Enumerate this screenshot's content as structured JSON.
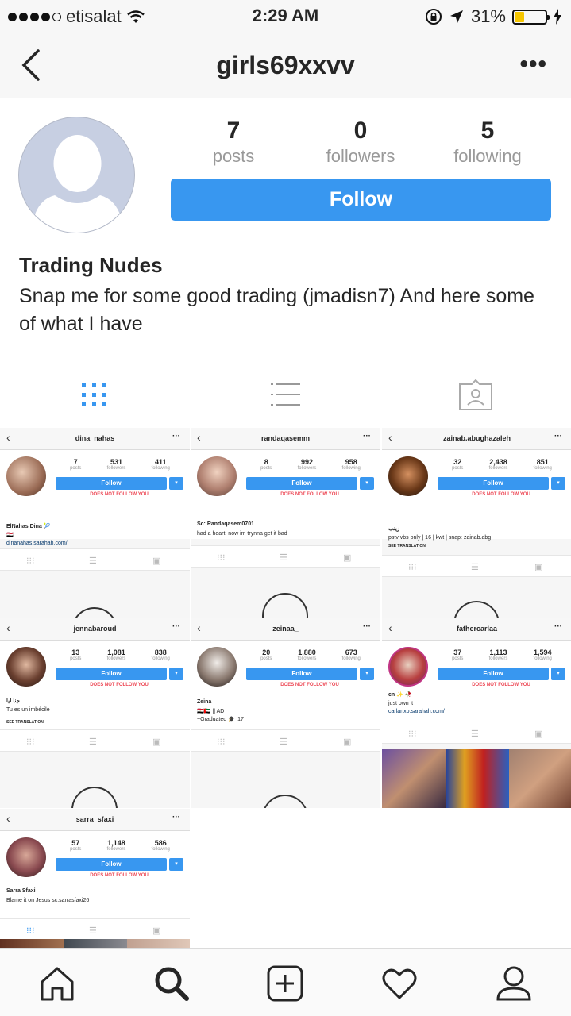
{
  "status_bar": {
    "carrier": "etisalat",
    "time": "2:29 AM",
    "battery": "31%"
  },
  "nav": {
    "title": "girls69xxvv"
  },
  "profile": {
    "posts_count": "7",
    "posts_label": "posts",
    "followers_count": "0",
    "followers_label": "followers",
    "following_count": "5",
    "following_label": "following",
    "follow_button": "Follow",
    "name": "Trading Nudes",
    "bio": "Snap me for some good trading (jmadisn7) And here some of what I have"
  },
  "posts": [
    {
      "username": "dina_nahas",
      "posts": "7",
      "followers": "531",
      "following": "411",
      "posts_label": "posts",
      "followers_label": "followers",
      "following_label": "following",
      "follow": "Follow",
      "dnf": "DOES NOT FOLLOW YOU",
      "name": "ElNahas Dina 🎾",
      "bio_line1": "🇪🇬",
      "bio_line2": "dinanahas.sarahah.com/",
      "see_translation": ""
    },
    {
      "username": "randaqasemm",
      "posts": "8",
      "followers": "992",
      "following": "958",
      "posts_label": "posts",
      "followers_label": "followers",
      "following_label": "following",
      "follow": "Follow",
      "dnf": "DOES NOT FOLLOW YOU",
      "name": "Sc: Randaqasem0701",
      "bio_line1": "had a heart; now im trynna get it bad",
      "bio_line2": "",
      "see_translation": ""
    },
    {
      "username": "zainab.abughazaleh",
      "posts": "32",
      "followers": "2,438",
      "following": "851",
      "posts_label": "posts",
      "followers_label": "followers",
      "following_label": "following",
      "follow": "Follow",
      "dnf": "DOES NOT FOLLOW YOU",
      "name": "زينب",
      "bio_line1": "pstv vbs only | 16 | kwt | snap: zainab.abg",
      "bio_line2": "",
      "see_translation": "SEE TRANSLATION"
    },
    {
      "username": "jennabaroud",
      "posts": "13",
      "followers": "1,081",
      "following": "838",
      "posts_label": "posts",
      "followers_label": "followers",
      "following_label": "following",
      "follow": "Follow",
      "dnf": "DOES NOT FOLLOW YOU",
      "name": "جنا ليا",
      "bio_line1": "Tu es un imbécile",
      "bio_line2": "",
      "see_translation": "SEE TRANSLATION"
    },
    {
      "username": "zeinaa_",
      "posts": "20",
      "followers": "1,880",
      "following": "673",
      "posts_label": "posts",
      "followers_label": "followers",
      "following_label": "following",
      "follow": "Follow",
      "dnf": "DOES NOT FOLLOW YOU",
      "name": "Zeina",
      "bio_line1": "🇪🇬🇦🇪 || AD",
      "bio_line2": "~Graduated 🎓 '17",
      "see_translation": ""
    },
    {
      "username": "fathercarlaa",
      "posts": "37",
      "followers": "1,113",
      "following": "1,594",
      "posts_label": "posts",
      "followers_label": "followers",
      "following_label": "following",
      "follow": "Follow",
      "dnf": "DOES NOT FOLLOW YOU",
      "name": "cn ✨ 🥀",
      "bio_line1": "just own it",
      "bio_line2": "carlanxo.sarahah.com/",
      "see_translation": ""
    },
    {
      "username": "sarra_sfaxi",
      "posts": "57",
      "followers": "1,148",
      "following": "586",
      "posts_label": "posts",
      "followers_label": "followers",
      "following_label": "following",
      "follow": "Follow",
      "dnf": "DOES NOT FOLLOW YOU",
      "name": "Sarra Sfaxi",
      "bio_line1": "Blame it on Jesus sc:sarrasfaxi26",
      "bio_line2": "",
      "see_translation": ""
    }
  ],
  "icons": {
    "back": "chevron-left-icon",
    "more": "more-icon",
    "grid": "grid-icon",
    "list": "list-icon",
    "tagged": "tagged-icon",
    "home": "home-icon",
    "search": "search-icon",
    "add": "add-post-icon",
    "activity": "heart-icon",
    "profile": "profile-icon"
  },
  "colors": {
    "accent": "#3897f0",
    "warning": "#ed4956",
    "battery": "#f6c600"
  }
}
